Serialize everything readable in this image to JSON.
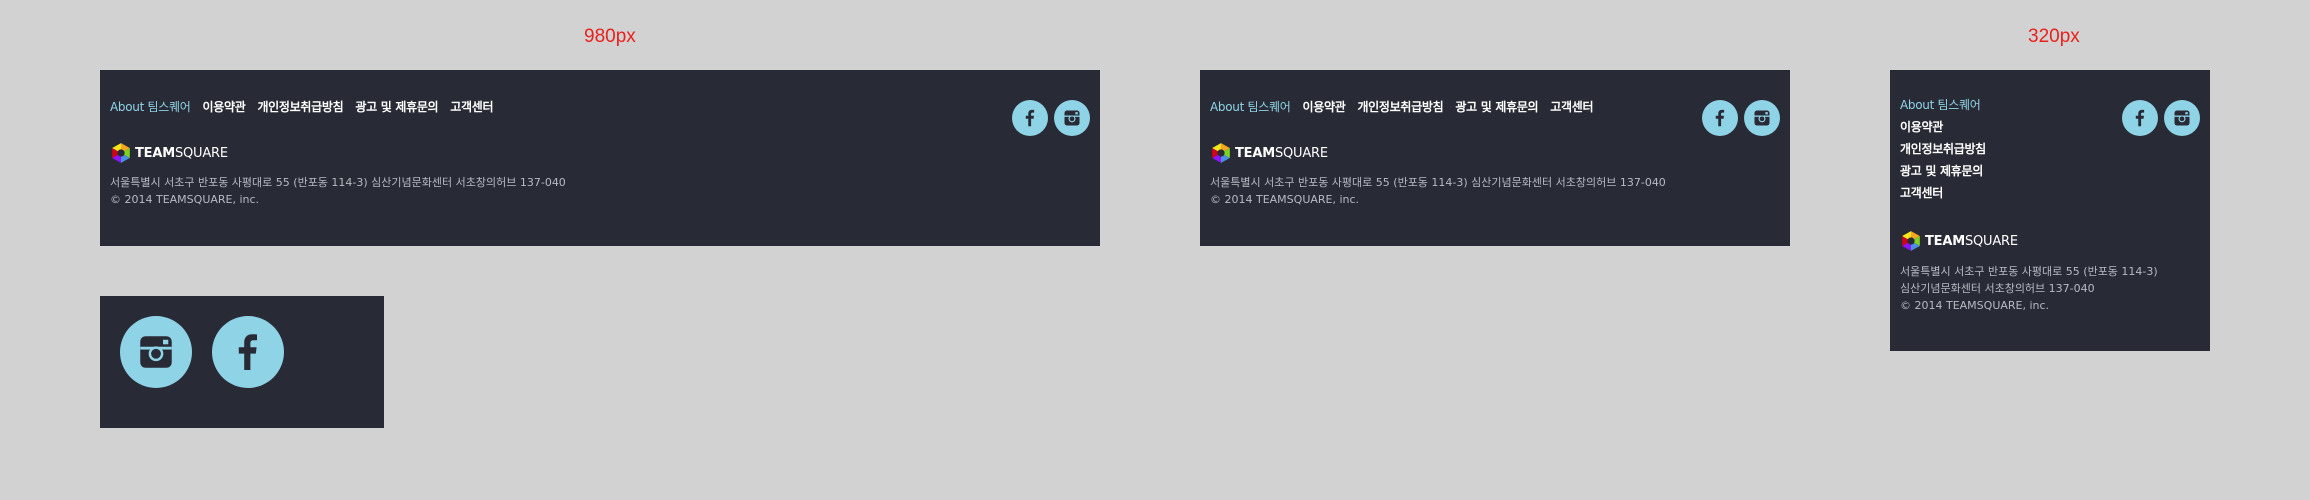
{
  "labels": {
    "wide": "980px",
    "narrow": "320px"
  },
  "nav": {
    "about": "About 팀스퀘어",
    "terms": "이용약관",
    "privacy": "개인정보취급방침",
    "ads": "광고 및 제휴문의",
    "support": "고객센터"
  },
  "logo": {
    "bold": "TEAM",
    "light": "SQUARE"
  },
  "address": {
    "full": "서울특별시 서초구 반포동 사평대로 55 (반포동 114-3) 심산기념문화센터 서초창의허브 137-040",
    "line1": "서울특별시 서초구 반포동 사평대로 55 (반포동 114-3)",
    "line2": "심산기념문화센터 서초창의허브 137-040",
    "copyright": "© 2014 TEAMSQUARE, inc."
  },
  "icons": {
    "facebook": "facebook-icon",
    "instagram": "instagram-icon"
  },
  "colors": {
    "background": "#d2d2d2",
    "footer": "#282b36",
    "accent": "#8fd3e6",
    "label": "#e8221e"
  }
}
